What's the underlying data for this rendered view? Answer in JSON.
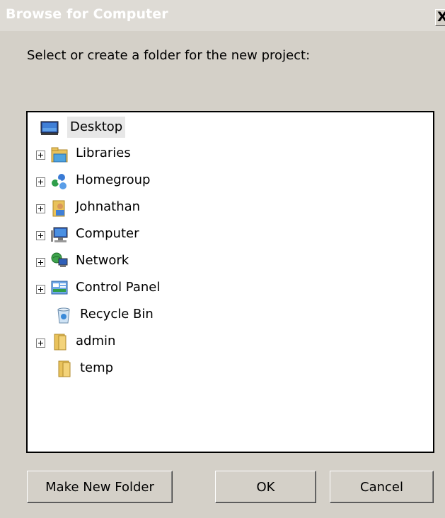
{
  "window": {
    "title": "Browse for Computer",
    "close_glyph": "X"
  },
  "prompt": "Select or create a folder for the new project:",
  "tree": {
    "items": [
      {
        "label": "Desktop",
        "icon": "desktop-icon",
        "expandable": false,
        "selected": true
      },
      {
        "label": "Libraries",
        "icon": "libraries-icon",
        "expandable": true,
        "selected": false
      },
      {
        "label": "Homegroup",
        "icon": "homegroup-icon",
        "expandable": true,
        "selected": false
      },
      {
        "label": "Johnathan",
        "icon": "user-folder-icon",
        "expandable": true,
        "selected": false
      },
      {
        "label": "Computer",
        "icon": "computer-icon",
        "expandable": true,
        "selected": false
      },
      {
        "label": "Network",
        "icon": "network-icon",
        "expandable": true,
        "selected": false
      },
      {
        "label": "Control Panel",
        "icon": "control-panel-icon",
        "expandable": true,
        "selected": false
      },
      {
        "label": "Recycle Bin",
        "icon": "recycle-bin-icon",
        "expandable": false,
        "selected": false
      },
      {
        "label": "admin",
        "icon": "folder-icon",
        "expandable": true,
        "selected": false
      },
      {
        "label": "temp",
        "icon": "folder-icon",
        "expandable": false,
        "selected": false
      }
    ]
  },
  "buttons": {
    "make_new_folder": "Make New Folder",
    "ok": "OK",
    "cancel": "Cancel"
  },
  "colors": {
    "dialog_bg": "#d4d0c8",
    "titlebar_bg": "#dedbd5",
    "title_text": "#ffffff",
    "tree_bg": "#ffffff",
    "selection_bg": "#e7e7e7"
  }
}
